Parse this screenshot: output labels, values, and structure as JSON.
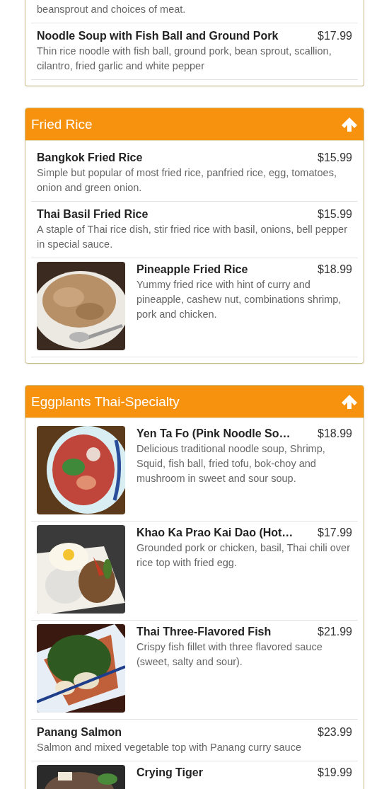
{
  "sections": [
    {
      "items": [
        {
          "description": "beansprout and choices of meat."
        },
        {
          "name": "Noodle Soup with Fish Ball and Ground Pork",
          "price": "$17.99",
          "description": "Thin rice noodle with fish ball, ground pork, bean sprout, scallion, cilantro, fried garlic and white pepper"
        }
      ]
    },
    {
      "title": "Fried Rice",
      "items": [
        {
          "name": "Bangkok Fried Rice",
          "price": "$15.99",
          "description": "Simple but popular of most fried rice, panfried rice, egg, tomatoes, onion and green onion."
        },
        {
          "name": "Thai Basil Fried Rice",
          "price": "$15.99",
          "description": "A staple of Thai rice dish, stir fried rice with basil, onions, bell pepper in special sauce."
        },
        {
          "name": "Pineapple Fried Rice",
          "price": "$18.99",
          "description": "Yummy fried rice with hint of curry and pineapple, cashew nut, combinations shrimp, pork and chicken."
        }
      ]
    },
    {
      "title": "Eggplants Thai-Specialty",
      "items": [
        {
          "name": "Yen Ta Fo (Pink Noodle So…",
          "price": "$18.99",
          "description": "Delicious traditional noodle soup, Shrimp, Squid, fish ball, fried tofu, bok-choy and mushroom in sweet and sour soup."
        },
        {
          "name": "Khao Ka Prao Kai Dao (Hot…",
          "price": "$17.99",
          "description": "Grounded pork or chicken, basil, Thai chili over rice top with fried egg."
        },
        {
          "name": "Thai Three-Flavored Fish",
          "price": "$21.99",
          "description": "Crispy fish fillet with three flavored sauce (sweet, salty and sour)."
        },
        {
          "name": "Panang Salmon",
          "price": "$23.99",
          "description": "Salmon and mixed vegetable top with Panang curry sauce"
        },
        {
          "name": "Crying Tiger",
          "price": "$19.99"
        }
      ]
    }
  ]
}
